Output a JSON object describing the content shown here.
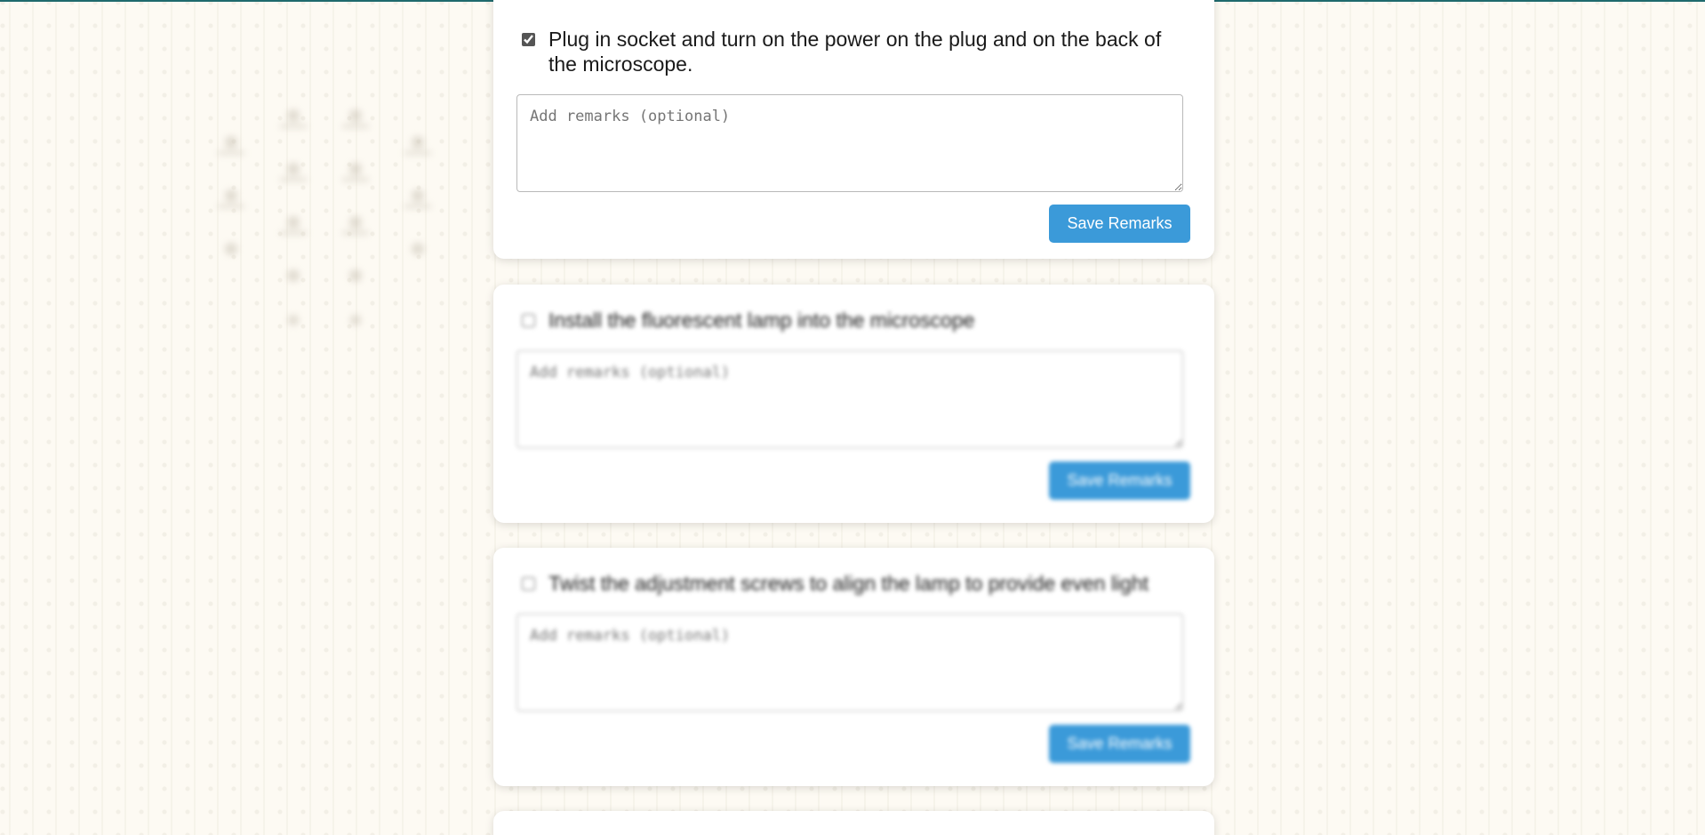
{
  "tasks": [
    {
      "label": "Plug in socket and turn on the power on the plug and on the back of the microscope.",
      "checked": true,
      "remarks_placeholder": "Add remarks (optional)",
      "save_label": "Save Remarks"
    },
    {
      "label": "Install the fluorescent lamp into the microscope",
      "checked": false,
      "remarks_placeholder": "Add remarks (optional)",
      "save_label": "Save Remarks"
    },
    {
      "label": "Twist the adjustment screws to align the lamp to provide even light",
      "checked": false,
      "remarks_placeholder": "Add remarks (optional)",
      "save_label": "Save Remarks"
    }
  ],
  "colors": {
    "top_strip": "#1f6a6d",
    "button": "#3b9ad9",
    "page_background": "#fdfaf3"
  },
  "icons": {
    "background_decoration": "microscope-pattern-icon"
  }
}
